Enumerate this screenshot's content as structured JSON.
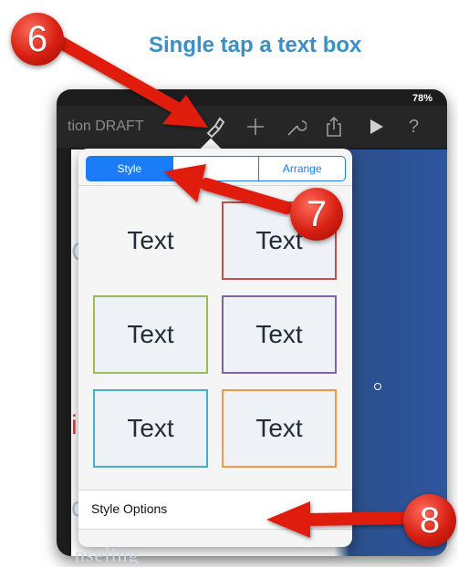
{
  "caption": "Single tap a text box",
  "steps": {
    "step6": "6",
    "step7": "7",
    "step8": "8"
  },
  "device": {
    "status": {
      "battery": "78%"
    },
    "toolbar": {
      "doc_title": "tion DRAFT",
      "icons": [
        "paintbrush-icon",
        "plus-icon",
        "wrench-icon",
        "share-icon",
        "play-icon",
        "help-icon"
      ]
    },
    "slide": {
      "partial_word": "nseling"
    }
  },
  "popover": {
    "tabs": [
      {
        "label": "Style",
        "active": true
      },
      {
        "label": "",
        "active": false
      },
      {
        "label": "Arrange",
        "active": false
      }
    ],
    "styles": [
      {
        "label": "Text",
        "border": "none"
      },
      {
        "label": "Text",
        "border": "#c0504d"
      },
      {
        "label": "Text",
        "border": "#9bbb59"
      },
      {
        "label": "Text",
        "border": "#8064a2"
      },
      {
        "label": "Text",
        "border": "#4bacc6"
      },
      {
        "label": "Text",
        "border": "#f79646"
      }
    ],
    "style_options": "Style Options"
  },
  "colors": {
    "accent": "#1a7cf6",
    "caption": "#3a8fc6",
    "badge": "#d61f12",
    "arrow": "#e01b10"
  }
}
